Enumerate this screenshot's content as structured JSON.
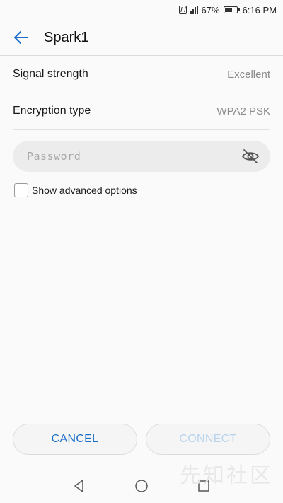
{
  "status_bar": {
    "battery": "67%",
    "time": "6:16 PM",
    "icons": [
      "nfc-icon",
      "signal-icon",
      "battery-icon"
    ]
  },
  "header": {
    "title": "Spark1",
    "back_icon": "arrow-left-icon",
    "accent_color": "#1a6fc9"
  },
  "details": [
    {
      "label": "Signal strength",
      "value": "Excellent"
    },
    {
      "label": "Encryption type",
      "value": "WPA2 PSK"
    }
  ],
  "password": {
    "placeholder": "Password",
    "value": "",
    "visibility_icon": "eye-off-icon"
  },
  "advanced": {
    "label": "Show advanced options",
    "checked": false
  },
  "actions": {
    "cancel": "CANCEL",
    "connect": "CONNECT",
    "connect_enabled": false
  },
  "nav_bar": {
    "icons": [
      "nav-back-icon",
      "nav-home-icon",
      "nav-recents-icon"
    ]
  },
  "watermark": {
    "text": "先知社区"
  }
}
